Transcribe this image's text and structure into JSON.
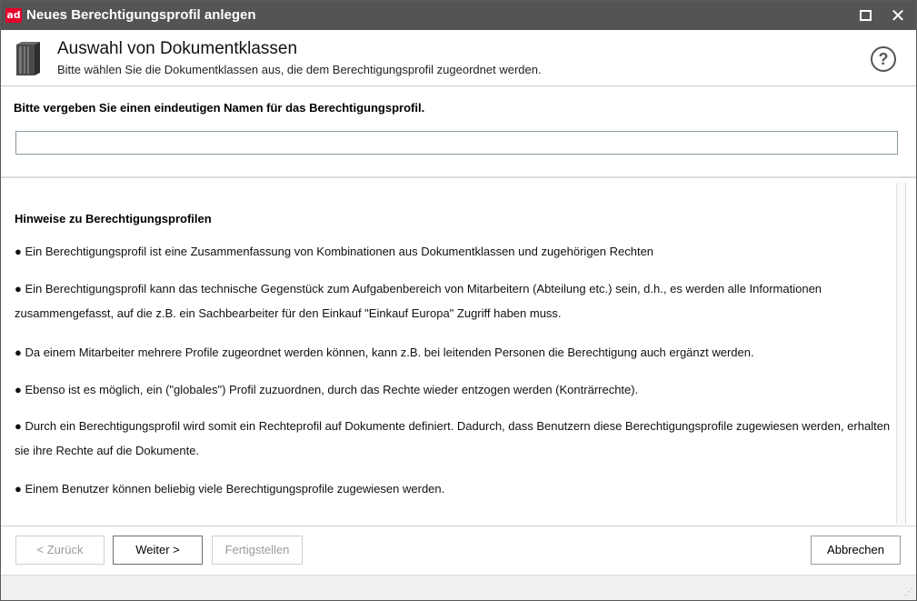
{
  "window": {
    "app_logo": "ad",
    "title": "Neues Berechtigungsprofil anlegen",
    "icons": {
      "maximize": "maximize-icon",
      "close": "close-icon"
    },
    "close_glyph": "✕"
  },
  "header": {
    "title": "Auswahl von Dokumentklassen",
    "subtitle": "Bitte wählen Sie die Dokumentklassen aus, die dem Berechtigungsprofil zugeordnet werden.",
    "icon": "book-icon",
    "help_glyph": "?"
  },
  "name_section": {
    "label": "Bitte vergeben Sie einen eindeutigen Namen für das Berechtigungsprofil.",
    "value": ""
  },
  "notes": {
    "title": "Hinweise zu Berechtigungsprofilen",
    "items": [
      "● Ein Berechtigungsprofil ist eine Zusammenfassung von Kombinationen aus Dokumentklassen und zugehörigen Rechten",
      "● Ein Berechtigungsprofil kann das technische Gegenstück zum Aufgabenbereich von Mitarbeitern (Abteilung etc.) sein, d.h., es werden alle Informationen zusammengefasst, auf die z.B. ein Sachbearbeiter für den Einkauf \"Einkauf Europa\" Zugriff haben muss.",
      "● Da einem Mitarbeiter mehrere Profile zugeordnet werden können, kann z.B. bei leitenden Personen die Berechtigung auch ergänzt werden.",
      "● Ebenso ist es möglich, ein (\"globales\") Profil zuzuordnen, durch das Rechte wieder entzogen werden (Konträrrechte).",
      "● Durch ein Berechtigungsprofil wird somit ein Rechteprofil auf Dokumente definiert. Dadurch, dass Benutzern diese Berechtigungsprofile zugewiesen werden, erhalten sie ihre Rechte auf die Dokumente.",
      "● Einem Benutzer können beliebig viele Berechtigungsprofile zugewiesen werden."
    ]
  },
  "footer": {
    "back": "< Zurück",
    "next": "Weiter >",
    "finish": "Fertigstellen",
    "cancel": "Abbrechen"
  }
}
